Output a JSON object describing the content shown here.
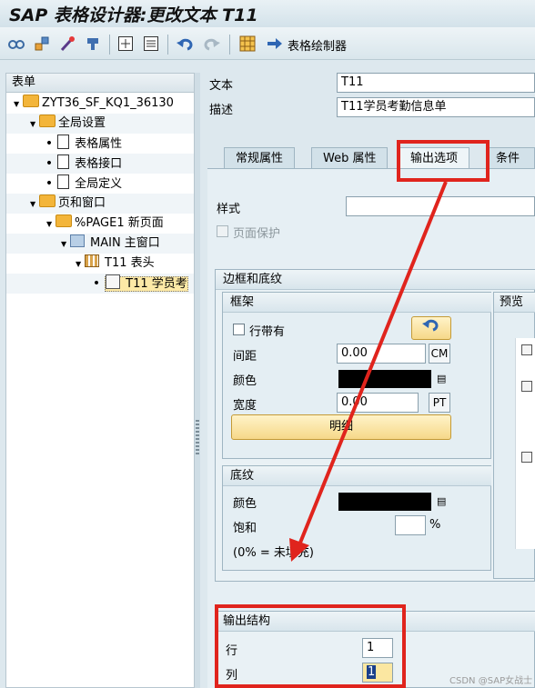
{
  "window": {
    "title": "SAP 表格设计器:更改文本 T11"
  },
  "toolbar": {
    "icons": [
      "glasses-icon",
      "move-icon",
      "wand-icon",
      "plug-icon",
      "panel-plus-icon",
      "panel-list-icon",
      "undo-icon",
      "redo-icon",
      "grid-icon",
      "arrow-right-icon"
    ],
    "draw_label": "表格绘制器"
  },
  "tree": {
    "header": "表单",
    "nodes": [
      {
        "label": "ZYT36_SF_KQ1_36130"
      },
      {
        "label": "全局设置"
      },
      {
        "label": "表格属性"
      },
      {
        "label": "表格接口"
      },
      {
        "label": "全局定义"
      },
      {
        "label": "页和窗口"
      },
      {
        "label": "%PAGE1 新页面"
      },
      {
        "label": "MAIN 主窗口"
      },
      {
        "label": "T11 表头"
      },
      {
        "label": "T11 学员考"
      }
    ]
  },
  "form": {
    "text_label": "文本",
    "text_value": "T11",
    "desc_label": "描述",
    "desc_value": "T11学员考勤信息单"
  },
  "tabs": [
    {
      "label": "常规属性",
      "active": false
    },
    {
      "label": "Web 属性",
      "active": false
    },
    {
      "label": "输出选项",
      "active": true
    },
    {
      "label": "条件",
      "active": false
    }
  ],
  "output_options": {
    "style_label": "样式",
    "style_value": "",
    "page_protect_label": "页面保护",
    "border_group": {
      "title": "边框和底纹",
      "frame": {
        "title": "框架",
        "line_checkbox_label": "行带有",
        "spacing_label": "间距",
        "spacing_value": "0.00",
        "spacing_unit": "CM",
        "color_label": "颜色",
        "color_value": "#000000",
        "width_label": "宽度",
        "width_value": "0.00",
        "width_unit": "PT",
        "detail_button": "明细"
      },
      "preview_title": "预览",
      "shading": {
        "title": "底纹",
        "color_label": "颜色",
        "color_value": "#000000",
        "saturation_label": "饱和",
        "saturation_value": "",
        "saturation_unit": "%",
        "note": "(0% = 未填充)"
      }
    },
    "output_structure": {
      "title": "输出结构",
      "row_label": "行",
      "row_value": "1",
      "col_label": "列",
      "col_value": "1"
    }
  },
  "annotation_color": "#e0241d",
  "watermark": "CSDN @SAP女战士"
}
